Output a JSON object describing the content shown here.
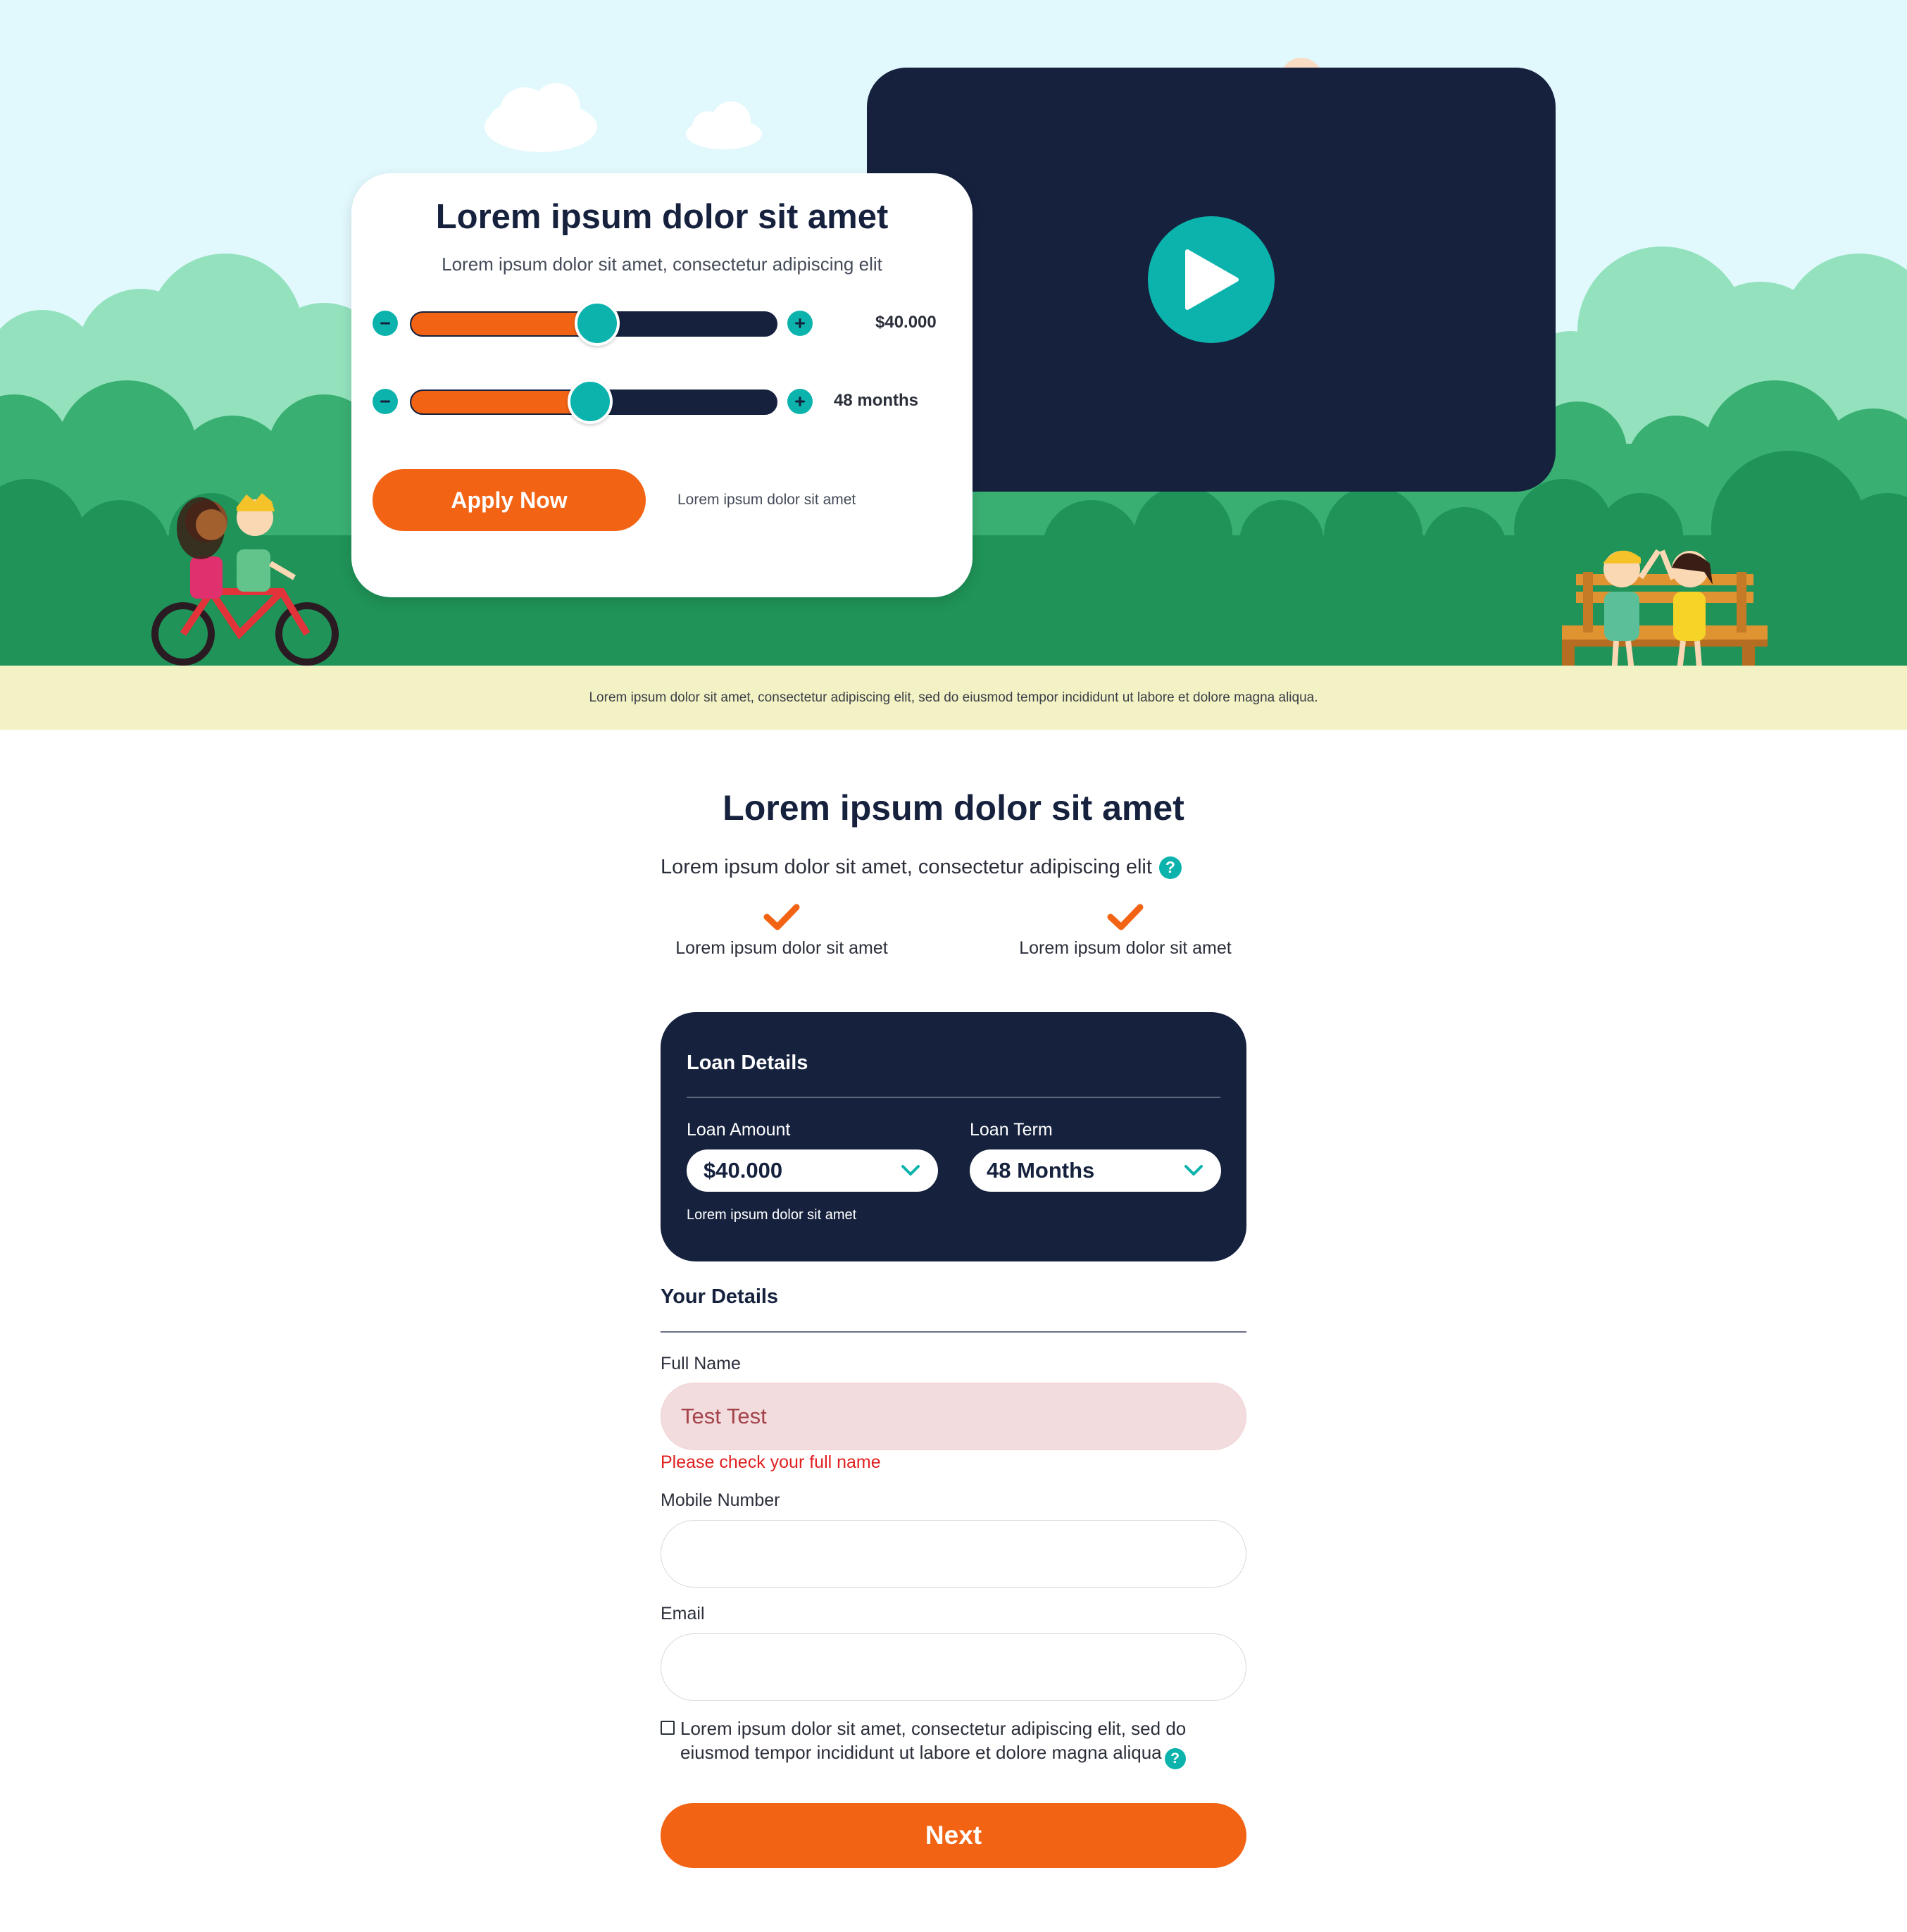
{
  "hero": {
    "footnote": "Lorem ipsum dolor sit amet, consectetur adipiscing elit, sed do eiusmod tempor incididunt ut labore et dolore magna aliqua."
  },
  "calculator": {
    "title": "Lorem ipsum dolor sit amet",
    "subtitle": "Lorem ipsum dolor sit amet, consectetur adipiscing elit",
    "amount_slider": {
      "value_label": "$40.000",
      "level": 0.51
    },
    "term_slider": {
      "value_label": "48 months",
      "level": 0.49
    },
    "apply_label": "Apply Now",
    "apply_note": "Lorem ipsum dolor sit amet",
    "icons": {
      "decrease": "minus-icon",
      "increase": "plus-icon"
    }
  },
  "video": {
    "icon": "play-icon"
  },
  "section": {
    "title": "Lorem ipsum dolor sit amet",
    "subtitle": "Lorem ipsum dolor sit amet, consectetur adipiscing elit",
    "help_glyph": "?",
    "features": [
      {
        "icon": "check-icon",
        "label": "Lorem ipsum dolor sit amet"
      },
      {
        "icon": "check-icon",
        "label": "Lorem ipsum dolor sit amet"
      }
    ]
  },
  "loan_details": {
    "title": "Loan Details",
    "amount_label": "Loan Amount",
    "amount_value": "$40.000",
    "term_label": "Loan Term",
    "term_value": "48 Months",
    "note": "Lorem ipsum dolor sit amet"
  },
  "your_details": {
    "title": "Your Details",
    "full_name_label": "Full Name",
    "full_name_value": "Test Test",
    "full_name_error": "Please check your full name",
    "mobile_label": "Mobile Number",
    "mobile_value": "",
    "email_label": "Email",
    "email_value": "",
    "consent_text": "Lorem ipsum dolor sit amet, consectetur adipiscing elit, sed do eiusmod tempor incididunt ut labore et dolore magna aliqua",
    "consent_checked": false
  },
  "next_label": "Next",
  "colors": {
    "navy": "#15213d",
    "orange": "#f26314",
    "teal": "#0cb3ad",
    "sky": "#e1f8fd",
    "ground": "#f3f2c4",
    "error": "#e02020",
    "error_bg": "#f3dcdd"
  }
}
